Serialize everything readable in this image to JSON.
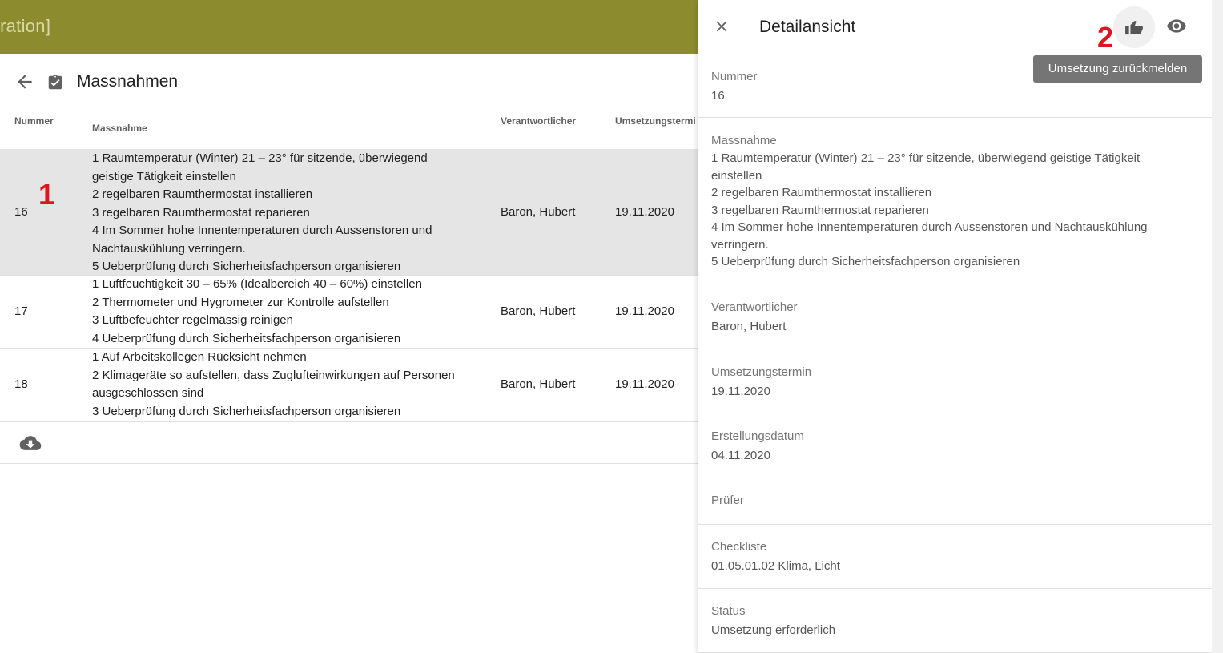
{
  "app": {
    "title_fragment": "ration]"
  },
  "header": {
    "title": "Massnahmen"
  },
  "columns": {
    "nummer": "Nummer",
    "massnahme": "Massnahme",
    "verantwortlicher": "Verantwortlicher",
    "umsetzungstermin": "Umsetzungstermi"
  },
  "rows": [
    {
      "nummer": "16",
      "massnahme": [
        "1 Raumtemperatur (Winter) 21 – 23° für sitzende, überwiegend",
        "geistige Tätigkeit einstellen",
        "2 regelbaren Raumthermostat installieren",
        "3 regelbaren Raumthermostat reparieren",
        "4 Im Sommer hohe Innentemperaturen durch Aussenstoren und",
        "Nachtauskühlung verringern.",
        "5 Ueberprüfung durch Sicherheitsfachperson organisieren"
      ],
      "verantwortlicher": "Baron, Hubert",
      "termin": "19.11.2020"
    },
    {
      "nummer": "17",
      "massnahme": [
        "1 Luftfeuchtigkeit 30 – 65% (Idealbereich 40 – 60%) einstellen",
        "2 Thermometer und Hygrometer zur Kontrolle aufstellen",
        "3 Luftbefeuchter regelmässig reinigen",
        "4 Ueberprüfung durch Sicherheitsfachperson organisieren"
      ],
      "verantwortlicher": "Baron, Hubert",
      "termin": "19.11.2020"
    },
    {
      "nummer": "18",
      "massnahme": [
        "1 Auf Arbeitskollegen Rücksicht nehmen",
        "2 Klimageräte so aufstellen, dass Zuglufteinwirkungen auf Personen",
        "ausgeschlossen sind",
        "3 Ueberprüfung durch Sicherheitsfachperson organisieren"
      ],
      "verantwortlicher": "Baron, Hubert",
      "termin": "19.11.2020"
    }
  ],
  "annotations": {
    "one": "1",
    "two": "2"
  },
  "detail": {
    "title": "Detailansicht",
    "tooltip": "Umsetzung zurückmelden",
    "fields": {
      "nummer": {
        "label": "Nummer",
        "value": "16"
      },
      "massnahme": {
        "label": "Massnahme",
        "lines": [
          "1 Raumtemperatur (Winter) 21 – 23° für sitzende, überwiegend geistige Tätigkeit",
          "einstellen",
          "2 regelbaren Raumthermostat installieren",
          "3 regelbaren Raumthermostat reparieren",
          "4 Im Sommer hohe Innentemperaturen durch Aussenstoren und Nachtauskühlung",
          "verringern.",
          "5 Ueberprüfung durch Sicherheitsfachperson organisieren"
        ]
      },
      "verantwortlicher": {
        "label": "Verantwortlicher",
        "value": "Baron, Hubert"
      },
      "umsetzungstermin": {
        "label": "Umsetzungstermin",
        "value": "19.11.2020"
      },
      "erstellungsdatum": {
        "label": "Erstellungsdatum",
        "value": "04.11.2020"
      },
      "pruefer": {
        "label": "Prüfer",
        "value": ""
      },
      "checkliste": {
        "label": "Checkliste",
        "value": "01.05.01.02 Klima, Licht"
      },
      "status": {
        "label": "Status",
        "value": "Umsetzung erforderlich"
      }
    }
  },
  "icons": {
    "back": "arrow-left-icon",
    "clipboard": "clipboard-check-icon",
    "cloud": "cloud-download-icon",
    "close": "close-icon",
    "thumb": "thumb-right-icon",
    "eye": "eye-icon"
  },
  "colors": {
    "topbar": "#8c8c2e",
    "selected_row": "#e5e5e5",
    "annotation": "#e0141e",
    "tooltip": "#757575"
  }
}
